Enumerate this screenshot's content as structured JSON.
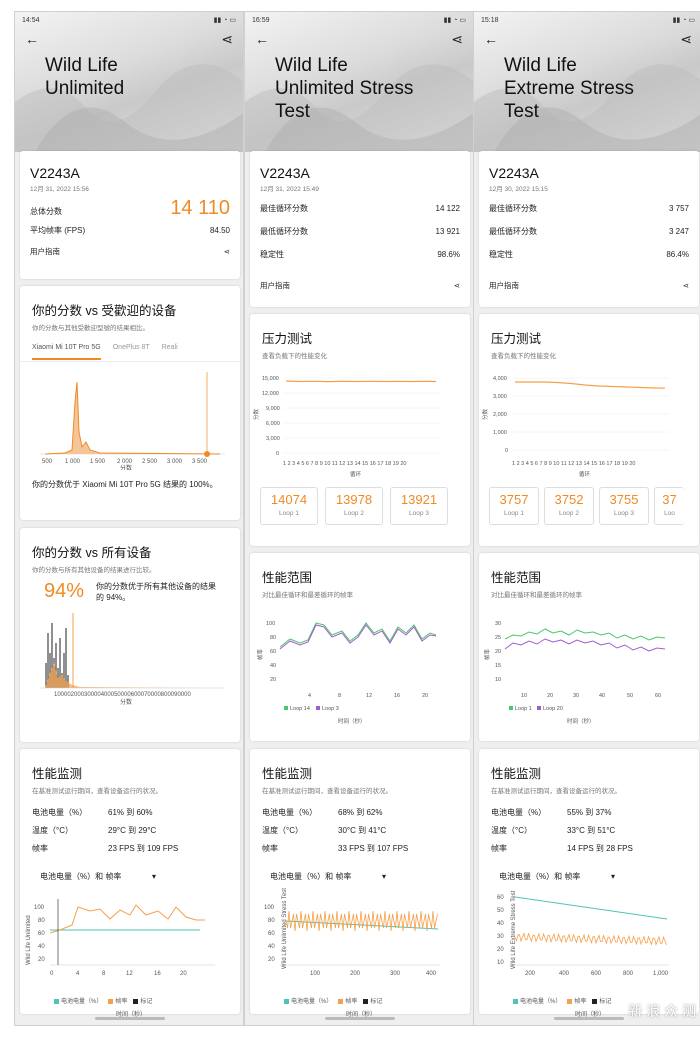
{
  "accent_color": "#f08a24",
  "phones": [
    {
      "time": "14:54",
      "title": "Wild Life\nUnlimited",
      "device": "V2243A",
      "date": "12月 31, 2022 15:56",
      "score_label": "总体分数",
      "score": "14 110",
      "fps_label": "平均帧率 (FPS)",
      "fps": "84.50",
      "guide": "用户指南",
      "popular": {
        "title": "你的分数 vs 受歡迎的设备",
        "subtitle": "你的分数与其他受歡迎型號的结果相比。",
        "tabs": [
          "Xiaomi Mi 10T Pro 5G",
          "OnePlus 8T",
          "Reali"
        ],
        "x_ticks": [
          "500",
          "1 000",
          "1 500",
          "2 000",
          "2 500",
          "3 000",
          "3 500"
        ],
        "x_label": "分数",
        "result": "你的分数优于 Xiaomi Mi 10T Pro 5G 结果的 100%。"
      },
      "all": {
        "title": "你的分数 vs 所有设备",
        "subtitle": "你的分数与所有其他设备的结果进行比较。",
        "percent": "94%",
        "text": "你的分数优于所有其他设备的结果的 94%。",
        "x_ticks": "10000200030000400050000600070000800090000",
        "x_label": "分数"
      },
      "monitor": {
        "title": "性能监测",
        "subtitle": "在基准测试运行期间，查看设备运行的状况。",
        "rows": [
          {
            "k": "电池电量（%）",
            "v": "61% 到 60%"
          },
          {
            "k": "温度（°C）",
            "v": "29°C 到 29°C"
          },
          {
            "k": "帧率",
            "v": "23 FPS 到 109 FPS"
          }
        ],
        "dropdown": "电池电量（%）和 帧率",
        "y_ticks": [
          "100",
          "80",
          "60",
          "40",
          "20"
        ],
        "x_ticks": [
          "0",
          "4",
          "8",
          "12",
          "16",
          "20"
        ],
        "rot_label": "Wild Life Unlimited",
        "x_label": "时间（秒）",
        "legend": [
          "电池电量（%）",
          "帧率",
          "标记"
        ]
      }
    },
    {
      "time": "16:59",
      "title": "Wild Life\nUnlimited Stress\nTest",
      "device": "V2243A",
      "date": "12月 31, 2022 15:49",
      "rows": [
        {
          "k": "最佳循环分数",
          "v": "14 122"
        },
        {
          "k": "最低循环分数",
          "v": "13 921"
        },
        {
          "k": "稳定性",
          "v": "98.6%"
        }
      ],
      "guide": "用户指南",
      "stress": {
        "title": "压力测试",
        "subtitle": "查看负载下的性能变化",
        "y_ticks": [
          "15,000",
          "12,000",
          "9,000",
          "6,000",
          "3,000",
          "0"
        ],
        "y_label": "分数",
        "x_label": "循环",
        "loops": [
          {
            "v": "14074",
            "l": "Loop 1"
          },
          {
            "v": "13978",
            "l": "Loop 2"
          },
          {
            "v": "13921",
            "l": "Loop 3"
          }
        ]
      },
      "range": {
        "title": "性能范围",
        "subtitle": "对比最佳循环和最差循环的帧率",
        "y_ticks": [
          "100",
          "80",
          "60",
          "40",
          "20"
        ],
        "x_ticks": [
          "4",
          "8",
          "12",
          "16",
          "20"
        ],
        "y_label": "帧率",
        "x_label": "时间（秒）",
        "legend": [
          "Loop 14",
          "Loop 3"
        ]
      },
      "monitor": {
        "title": "性能监测",
        "subtitle": "在基准测试运行期间，查看设备运行的状况。",
        "rows": [
          {
            "k": "电池电量（%）",
            "v": "68% 到 62%"
          },
          {
            "k": "温度（°C）",
            "v": "30°C 到 41°C"
          },
          {
            "k": "帧率",
            "v": "33 FPS 到 107 FPS"
          }
        ],
        "dropdown": "电池电量（%）和 帧率",
        "y_ticks": [
          "100",
          "80",
          "60",
          "40",
          "20"
        ],
        "x_ticks": [
          "100",
          "200",
          "300",
          "400"
        ],
        "rot_label": "Wild Life Unlimited Stress Test",
        "x_label": "时间（秒）",
        "legend": [
          "电池电量（%）",
          "帧率",
          "标记"
        ]
      }
    },
    {
      "time": "15:18",
      "title": "Wild Life\nExtreme Stress\nTest",
      "device": "V2243A",
      "date": "12月 30, 2022 15:15",
      "rows": [
        {
          "k": "最佳循环分数",
          "v": "3 757"
        },
        {
          "k": "最低循环分数",
          "v": "3 247"
        },
        {
          "k": "稳定性",
          "v": "86.4%"
        }
      ],
      "guide": "用户指南",
      "stress": {
        "title": "压力测试",
        "subtitle": "查看负载下的性能变化",
        "y_ticks": [
          "4,000",
          "3,000",
          "2,000",
          "1,000",
          "0"
        ],
        "y_label": "分数",
        "x_label": "循环",
        "loops": [
          {
            "v": "3757",
            "l": "Loop 1"
          },
          {
            "v": "3752",
            "l": "Loop 2"
          },
          {
            "v": "3755",
            "l": "Loop 3"
          },
          {
            "v": "37",
            "l": "Loo"
          }
        ]
      },
      "range": {
        "title": "性能范围",
        "subtitle": "对比最佳循环和最差循环的帧率",
        "y_ticks": [
          "30",
          "25",
          "20",
          "15",
          "10"
        ],
        "x_ticks": [
          "10",
          "20",
          "30",
          "40",
          "50",
          "60"
        ],
        "y_label": "帧率",
        "x_label": "时间（秒）",
        "legend": [
          "Loop 1",
          "Loop 20"
        ]
      },
      "monitor": {
        "title": "性能监测",
        "subtitle": "在基准测试运行期间，查看设备运行的状况。",
        "rows": [
          {
            "k": "电池电量（%）",
            "v": "55% 到 37%"
          },
          {
            "k": "温度（°C）",
            "v": "33°C 到 51°C"
          },
          {
            "k": "帧率",
            "v": "14 FPS 到 28 FPS"
          }
        ],
        "dropdown": "电池电量（%）和 帧率",
        "y_ticks": [
          "60",
          "50",
          "40",
          "30",
          "20",
          "10"
        ],
        "x_ticks": [
          "200",
          "400",
          "600",
          "800",
          "1,000"
        ],
        "rot_label": "Wild Life Extreme Stress Test",
        "x_label": "时间（秒）",
        "legend": [
          "电池电量（%）",
          "帧率",
          "标记"
        ]
      }
    }
  ],
  "watermark": "新 浪 众 测",
  "colors": {
    "battery": "#4fc3b4",
    "fps": "#f5a04a",
    "marker": "#222222",
    "loop_green": "#4cc66a",
    "loop_purple": "#a25bd1"
  }
}
